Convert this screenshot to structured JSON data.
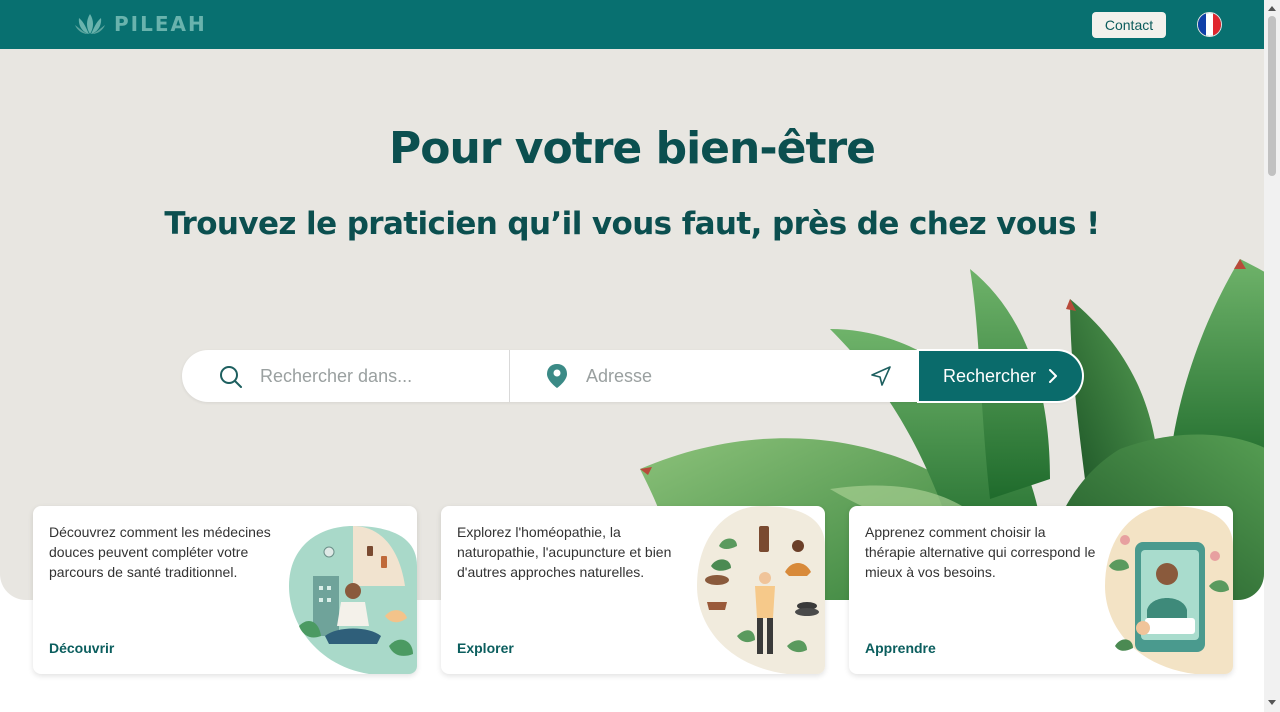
{
  "header": {
    "brand": "PILEAH",
    "contact_label": "Contact",
    "language": "fr",
    "colors": {
      "bar": "#087070",
      "logo": "#69b3ad"
    }
  },
  "hero": {
    "title": "Pour votre bien-être",
    "subtitle": "Trouvez le praticien qu’il vous faut, près de chez vous !"
  },
  "search": {
    "query_placeholder": "Rechercher dans...",
    "address_placeholder": "Adresse",
    "button_label": "Rechercher",
    "icons": [
      "search-icon",
      "map-pin-icon",
      "locate-arrow-icon",
      "chevron-right-icon"
    ]
  },
  "cards": [
    {
      "text": "Découvrez comment les médecines douces peuvent compléter votre parcours de santé traditionnel.",
      "link": "Découvrir"
    },
    {
      "text": "Explorez l'homéopathie, la naturopathie, l'acupuncture et bien d'autres approches naturelles.",
      "link": "Explorer"
    },
    {
      "text": "Apprenez comment choisir la thérapie alternative qui correspond le mieux à vos besoins.",
      "link": "Apprendre"
    }
  ]
}
